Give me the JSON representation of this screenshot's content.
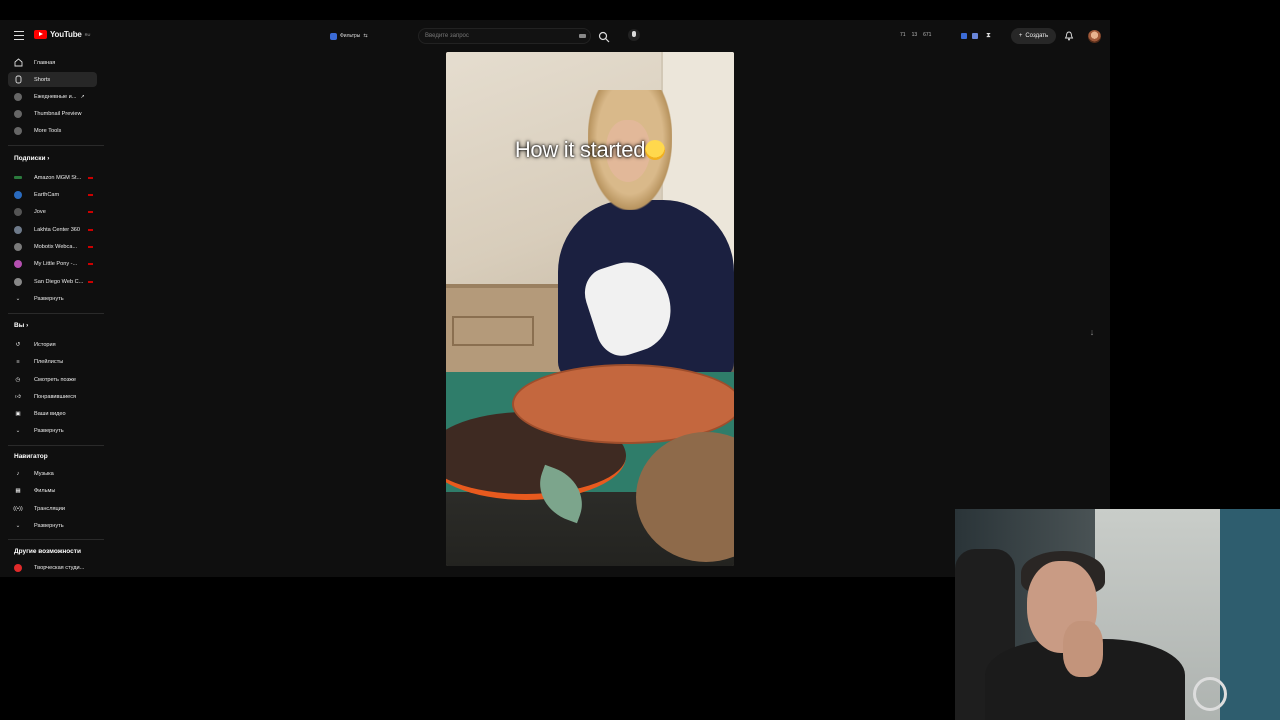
{
  "header": {
    "logo_text": "YouTube",
    "logo_sup": "RU",
    "filters_label": "Фильтры",
    "search_placeholder": "Введите запрос",
    "stats": [
      "71",
      "13",
      "671"
    ],
    "create_label": "Создать"
  },
  "sidebar": {
    "main": [
      {
        "label": "Главная",
        "icon": "home-icon"
      },
      {
        "label": "Shorts",
        "icon": "shorts-icon",
        "active": true
      },
      {
        "label": "Ежедневные и...",
        "icon": "extension-icon"
      },
      {
        "label": "Thumbnail Preview",
        "icon": "extension-icon"
      },
      {
        "label": "More Tools",
        "icon": "extension-icon"
      }
    ],
    "subscriptions_title": "Подписки",
    "subscriptions": [
      {
        "label": "Amazon MGM St...",
        "color": "#2b7a3d"
      },
      {
        "label": "EarthCam",
        "color": "#2a6bbf"
      },
      {
        "label": "Jove",
        "color": "#555555"
      },
      {
        "label": "Lakhta Center 360",
        "color": "#6e7a8a"
      },
      {
        "label": "Mobotix Webca...",
        "color": "#7a7a7a"
      },
      {
        "label": "My Little Pony -...",
        "color": "#b44fb0"
      },
      {
        "label": "San Diego Web C...",
        "color": "#888888"
      }
    ],
    "subscriptions_expand": "Развернуть",
    "you_title": "Вы",
    "you": [
      {
        "label": "История",
        "icon": "history-icon"
      },
      {
        "label": "Плейлисты",
        "icon": "playlist-icon"
      },
      {
        "label": "Смотреть позже",
        "icon": "clock-icon"
      },
      {
        "label": "Понравившиеся",
        "icon": "like-icon"
      },
      {
        "label": "Ваши видео",
        "icon": "video-icon"
      }
    ],
    "you_expand": "Развернуть",
    "nav_title": "Навигатор",
    "nav": [
      {
        "label": "Музыка",
        "icon": "music-icon"
      },
      {
        "label": "Фильмы",
        "icon": "film-icon"
      },
      {
        "label": "Трансляции",
        "icon": "live-icon"
      }
    ],
    "nav_expand": "Развернуть",
    "other_title": "Другие возможности",
    "other": [
      {
        "label": "Творческая студи...",
        "icon": "studio-icon"
      }
    ]
  },
  "video": {
    "caption": "How it started"
  }
}
